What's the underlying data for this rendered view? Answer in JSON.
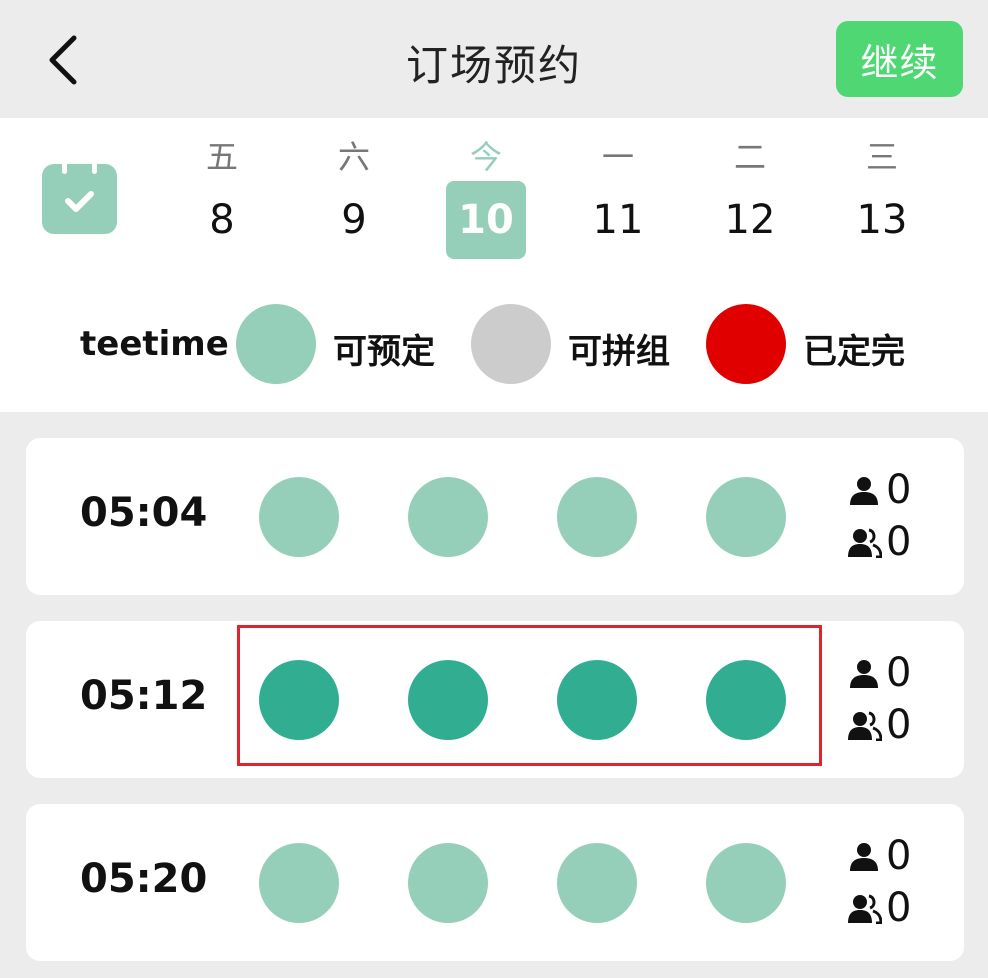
{
  "header": {
    "title": "订场预约",
    "continue_label": "继续",
    "back_icon": "chevron-left-icon",
    "accent_color": "#4fd773"
  },
  "calendar": {
    "icon": "calendar-check-icon",
    "days": [
      {
        "week": "五",
        "date": "8",
        "active": false
      },
      {
        "week": "六",
        "date": "9",
        "active": false
      },
      {
        "week": "今",
        "date": "10",
        "active": true
      },
      {
        "week": "一",
        "date": "11",
        "active": false
      },
      {
        "week": "二",
        "date": "12",
        "active": false
      },
      {
        "week": "三",
        "date": "13",
        "active": false
      }
    ],
    "active_color": "#95cfba"
  },
  "legend": {
    "title": "teetime",
    "items": [
      {
        "label": "可预定",
        "color": "#95cfba"
      },
      {
        "label": "可拼组",
        "color": "#cccccc"
      },
      {
        "label": "已定完",
        "color": "#e00000"
      }
    ]
  },
  "slots": [
    {
      "time": "05:04",
      "circles": [
        "#95cfba",
        "#95cfba",
        "#95cfba",
        "#95cfba"
      ],
      "single_count": "0",
      "group_count": "0"
    },
    {
      "time": "05:12",
      "circles": [
        "#31ae91",
        "#31ae91",
        "#31ae91",
        "#31ae91"
      ],
      "single_count": "0",
      "group_count": "0",
      "selected": true
    },
    {
      "time": "05:20",
      "circles": [
        "#95cfba",
        "#95cfba",
        "#95cfba",
        "#95cfba"
      ],
      "single_count": "0",
      "group_count": "0"
    }
  ],
  "selection_outline_color": "#e0242b"
}
